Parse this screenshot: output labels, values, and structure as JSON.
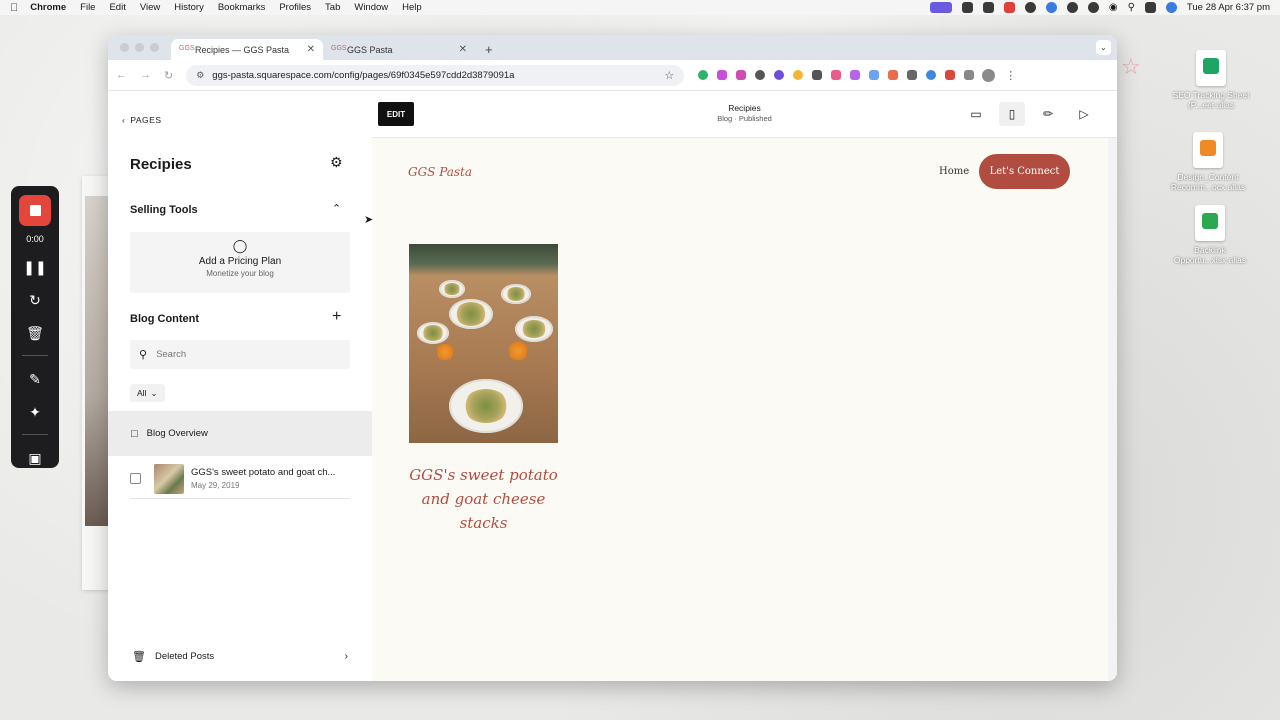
{
  "menubar": {
    "app": "Chrome",
    "items": [
      "File",
      "Edit",
      "View",
      "History",
      "Bookmarks",
      "Profiles",
      "Tab",
      "Window",
      "Help"
    ],
    "clock": "Tue 28 Apr  6:37 pm"
  },
  "recorder": {
    "time": "0:00"
  },
  "desktop_icons": [
    {
      "label": "SEO Tracking Sheet (P...eet alias",
      "color": "#1fa463"
    },
    {
      "label": "Design_Content Recomm...ocx alias",
      "color": "#f08a24"
    },
    {
      "label": "Backlink Opportu...xlsx alias",
      "color": "#2ca84f"
    }
  ],
  "browser": {
    "tabs": [
      {
        "title": "Recipies — GGS Pasta",
        "active": true
      },
      {
        "title": "GGS Pasta",
        "active": false
      }
    ],
    "url": "ggs-pasta.squarespace.com/config/pages/69f0345e597cdd2d3879091a"
  },
  "sidebar": {
    "back_label": "PAGES",
    "page_title": "Recipies",
    "selling_tools_label": "Selling Tools",
    "pricing_card": {
      "title": "Add a Pricing Plan",
      "subtitle": "Monetize your blog"
    },
    "blog_content_label": "Blog Content",
    "search_placeholder": "Search",
    "filter_label": "All",
    "overview_label": "Blog Overview",
    "posts": [
      {
        "title": "GGS's sweet potato and goat ch...",
        "date": "May 29, 2019"
      }
    ],
    "deleted_label": "Deleted Posts"
  },
  "preview": {
    "edit_label": "EDIT",
    "page_name": "Recipies",
    "page_status": "Blog · Published"
  },
  "site": {
    "logo": "GGS Pasta",
    "nav_home": "Home",
    "cta_label": "Let's Connect",
    "post_title": "GGS's sweet potato and goat cheese stacks"
  },
  "colors": {
    "brand": "#b04d40",
    "record_red": "#e5463c"
  }
}
